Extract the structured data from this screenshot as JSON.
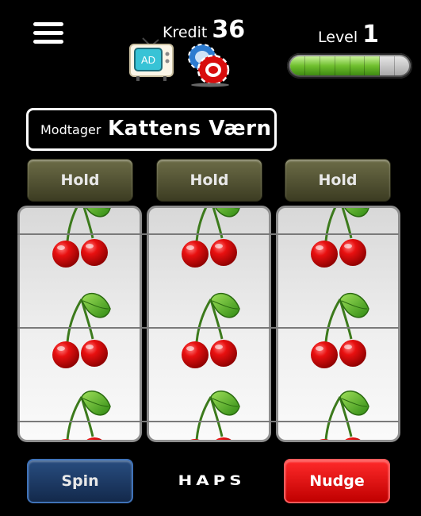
{
  "header": {
    "credit_label": "Kredit",
    "credit_value": "36",
    "level_label": "Level",
    "level_value": "1",
    "level_progress": 0.75,
    "ad_label": "AD"
  },
  "recipient": {
    "label": "Modtager",
    "name": "Kattens Værn"
  },
  "hold_buttons": [
    "Hold",
    "Hold",
    "Hold"
  ],
  "reels": [
    {
      "symbols": [
        "cherries",
        "cherries",
        "cherries"
      ]
    },
    {
      "symbols": [
        "cherries",
        "cherries",
        "cherries"
      ]
    },
    {
      "symbols": [
        "cherries",
        "cherries",
        "cherries"
      ]
    }
  ],
  "controls": {
    "spin_label": "Spin",
    "nudge_label": "Nudge"
  },
  "brand": "HAPS",
  "colors": {
    "spin": "#1c3a66",
    "nudge": "#e00000",
    "hold": "#55553a",
    "progress": "#6fbf2e"
  }
}
